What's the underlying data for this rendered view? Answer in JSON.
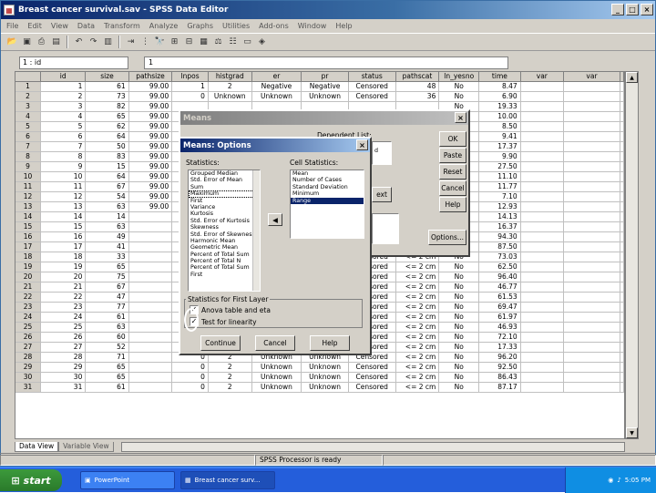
{
  "window": {
    "title": "Breast cancer survival.sav - SPSS Data Editor"
  },
  "menu": [
    "File",
    "Edit",
    "View",
    "Data",
    "Transform",
    "Analyze",
    "Graphs",
    "Utilities",
    "Add-ons",
    "Window",
    "Help"
  ],
  "cell_ref": "1 : id",
  "cell_value": "1",
  "columns": [
    "id",
    "size",
    "pathsize",
    "lnpos",
    "histgrad",
    "er",
    "pr",
    "status",
    "pathscat",
    "ln_yesno",
    "time",
    "var",
    "var"
  ],
  "rows": [
    [
      "1",
      "61",
      "99.00",
      "1",
      "2",
      "Negative",
      "Negative",
      "Censored",
      "48",
      "No",
      "8.47"
    ],
    [
      "2",
      "73",
      "99.00",
      "0",
      "Unknown",
      "Unknown",
      "Unknown",
      "Censored",
      "36",
      "No",
      "6.90"
    ],
    [
      "3",
      "82",
      "99.00",
      "",
      "",
      "",
      "",
      "",
      "",
      "No",
      "19.33"
    ],
    [
      "4",
      "65",
      "99.00",
      "",
      "",
      "",
      "",
      "",
      "",
      "No",
      "10.00"
    ],
    [
      "5",
      "62",
      "99.00",
      "",
      "",
      "",
      "",
      "",
      "",
      "No",
      "8.50"
    ],
    [
      "6",
      "64",
      "99.00",
      "",
      "",
      "",
      "",
      "",
      "",
      "No",
      "9.41"
    ],
    [
      "7",
      "50",
      "99.00",
      "",
      "",
      "",
      "",
      "",
      "",
      "No",
      "17.37"
    ],
    [
      "8",
      "83",
      "99.00",
      "",
      "",
      "",
      "",
      "",
      "",
      "No",
      "9.90"
    ],
    [
      "9",
      "15",
      "99.00",
      "",
      "",
      "",
      "",
      "",
      "",
      "Yes",
      "27.50"
    ],
    [
      "10",
      "64",
      "99.00",
      "",
      "",
      "",
      "",
      "",
      "",
      "No",
      "11.10"
    ],
    [
      "11",
      "67",
      "99.00",
      "",
      "",
      "",
      "",
      "",
      "",
      "Yes",
      "11.77"
    ],
    [
      "12",
      "54",
      "99.00",
      "",
      "",
      "",
      "",
      "",
      "",
      "No",
      "7.10"
    ],
    [
      "13",
      "63",
      "99.00",
      "",
      "",
      "",
      "",
      "",
      "",
      "No",
      "12.93"
    ],
    [
      "14",
      "14",
      "",
      "",
      "",
      "",
      "",
      "",
      "",
      "No",
      "14.13"
    ],
    [
      "15",
      "63",
      "",
      "",
      "",
      "",
      "",
      "",
      "",
      "No",
      "16.37"
    ],
    [
      "16",
      "49",
      "",
      "",
      "",
      "",
      "",
      "",
      "",
      "No",
      "94.30"
    ],
    [
      "17",
      "41",
      "",
      "",
      "",
      "",
      "",
      "Censored",
      "<= 2 cm",
      "No",
      "87.50"
    ],
    [
      "18",
      "33",
      "",
      "",
      "",
      "",
      "",
      "Censored",
      "<= 2 cm",
      "No",
      "73.03"
    ],
    [
      "19",
      "65",
      "",
      "",
      "",
      "",
      "",
      "Censored",
      "<= 2 cm",
      "No",
      "62.50"
    ],
    [
      "20",
      "75",
      "",
      "",
      "",
      "",
      "",
      "Censored",
      "<= 2 cm",
      "No",
      "96.40"
    ],
    [
      "21",
      "67",
      "",
      "",
      "",
      "",
      "",
      "Censored",
      "<= 2 cm",
      "No",
      "46.77"
    ],
    [
      "22",
      "47",
      "",
      "",
      "",
      "",
      "",
      "Censored",
      "<= 2 cm",
      "No",
      "61.53"
    ],
    [
      "23",
      "77",
      "",
      "",
      "",
      "",
      "",
      "Censored",
      "<= 2 cm",
      "No",
      "69.47"
    ],
    [
      "24",
      "61",
      "",
      "",
      "2",
      "Unknown",
      "Unknown",
      "Censored",
      "<= 2 cm",
      "No",
      "61.97"
    ],
    [
      "25",
      "63",
      "",
      "",
      "2",
      "Unknown",
      "Unknown",
      "Censored",
      "<= 2 cm",
      "No",
      "46.93"
    ],
    [
      "26",
      "60",
      "",
      "0",
      "2",
      "Unknown",
      "Unknown",
      "Censored",
      "<= 2 cm",
      "No",
      "72.10"
    ],
    [
      "27",
      "52",
      "",
      "0",
      "3",
      "Negative",
      "Negative",
      "Censored",
      "<= 2 cm",
      "No",
      "17.33"
    ],
    [
      "28",
      "71",
      "",
      "0",
      "2",
      "Unknown",
      "Unknown",
      "Censored",
      "<= 2 cm",
      "No",
      "96.20"
    ],
    [
      "29",
      "65",
      "",
      "0",
      "2",
      "Unknown",
      "Unknown",
      "Censored",
      "<= 2 cm",
      "No",
      "92.50"
    ],
    [
      "30",
      "65",
      "",
      "0",
      "2",
      "Unknown",
      "Unknown",
      "Censored",
      "<= 2 cm",
      "No",
      "86.43"
    ],
    [
      "31",
      "61",
      "",
      "0",
      "2",
      "Unknown",
      "Unknown",
      "Censored",
      "<= 2 cm",
      "No",
      "87.17"
    ]
  ],
  "tabs": {
    "data_view": "Data View",
    "variable_view": "Variable View"
  },
  "status": {
    "processor": "SPSS Processor is ready"
  },
  "means_dialog": {
    "title": "Means",
    "dependent_label": "Dependent List:",
    "buttons": [
      "OK",
      "Paste",
      "Reset",
      "Cancel",
      "Help"
    ],
    "options_button": "Options..."
  },
  "options_dialog": {
    "title": "Means: Options",
    "statistics_label": "Statistics:",
    "cell_statistics_label": "Cell Statistics:",
    "statistics": [
      "Grouped Median",
      "Std. Error of Mean",
      "Sum",
      "Maximum",
      "First",
      "Variance",
      "Kurtosis",
      "Std. Error of Kurtosis",
      "Skewness",
      "Std. Error of Skewness",
      "Harmonic Mean",
      "Geometric Mean",
      "Percent of Total Sum",
      "Percent of Total N",
      "Percent of Total Sum",
      "First"
    ],
    "cell_statistics": [
      "Mean",
      "Number of Cases",
      "Standard Deviation",
      "Minimum",
      "Range"
    ],
    "first_layer_label": "Statistics for First Layer",
    "anova_label": "Anova table and eta",
    "linearity_label": "Test for linearity",
    "continue_label": "Continue",
    "cancel_label": "Cancel",
    "help_label": "Help"
  },
  "taskbar": {
    "start": "start",
    "items": [
      "PowerPoint",
      "Breast cancer surv..."
    ],
    "clock": "5:05 PM"
  }
}
